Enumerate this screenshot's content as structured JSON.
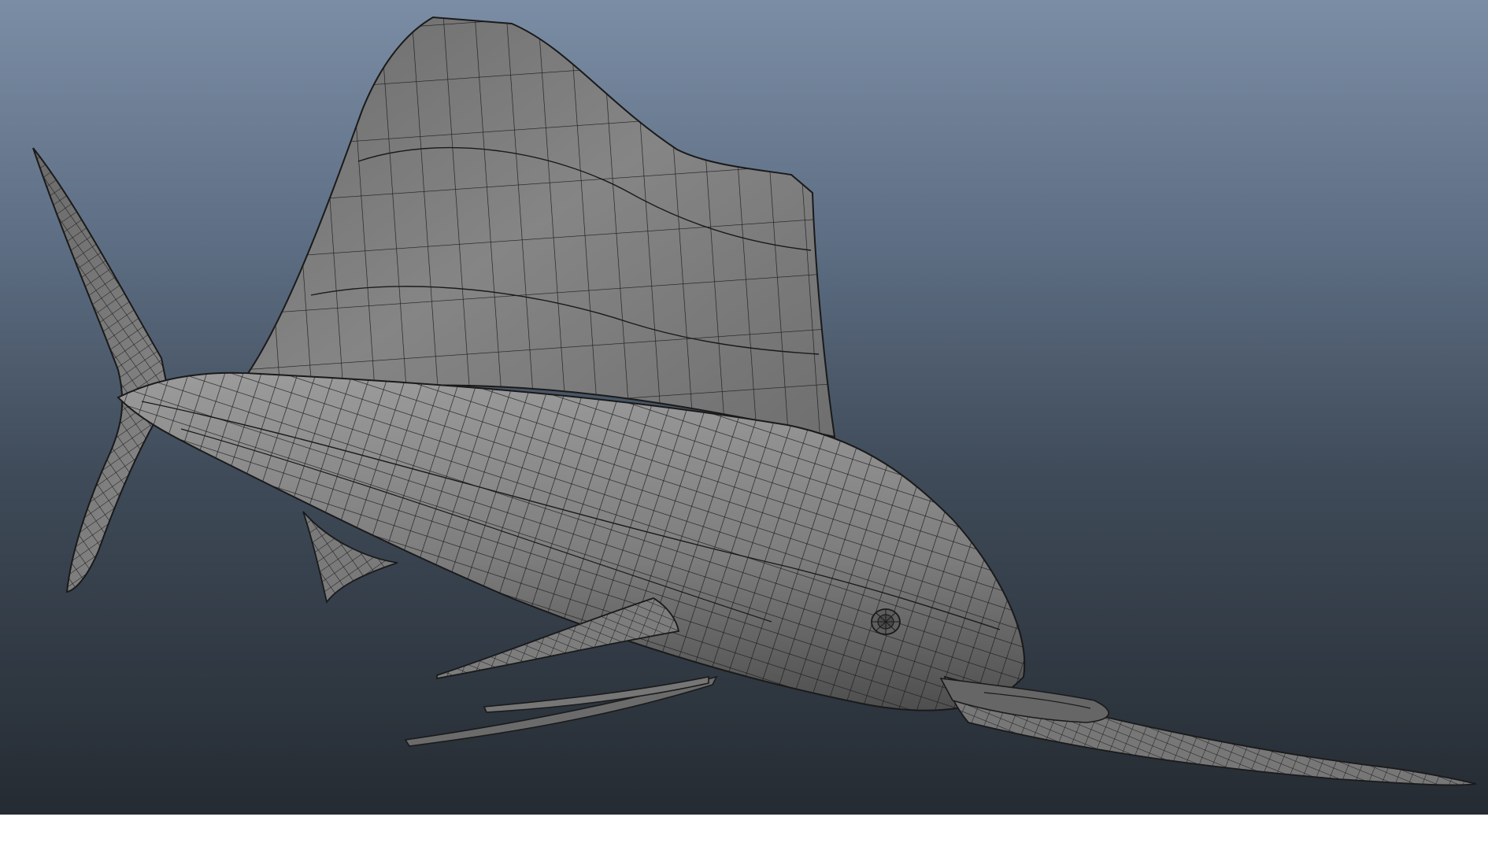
{
  "viewport": {
    "subject": "sailfish-polygon-wireframe",
    "shading": "smooth-shade-with-wireframe",
    "colors": {
      "background_top": "#7b8da4",
      "background_bottom": "#252b32",
      "mesh_fill": "#8a8a8a",
      "mesh_fill_dark": "#5a5a5a",
      "wire": "#1a1a1a"
    }
  }
}
